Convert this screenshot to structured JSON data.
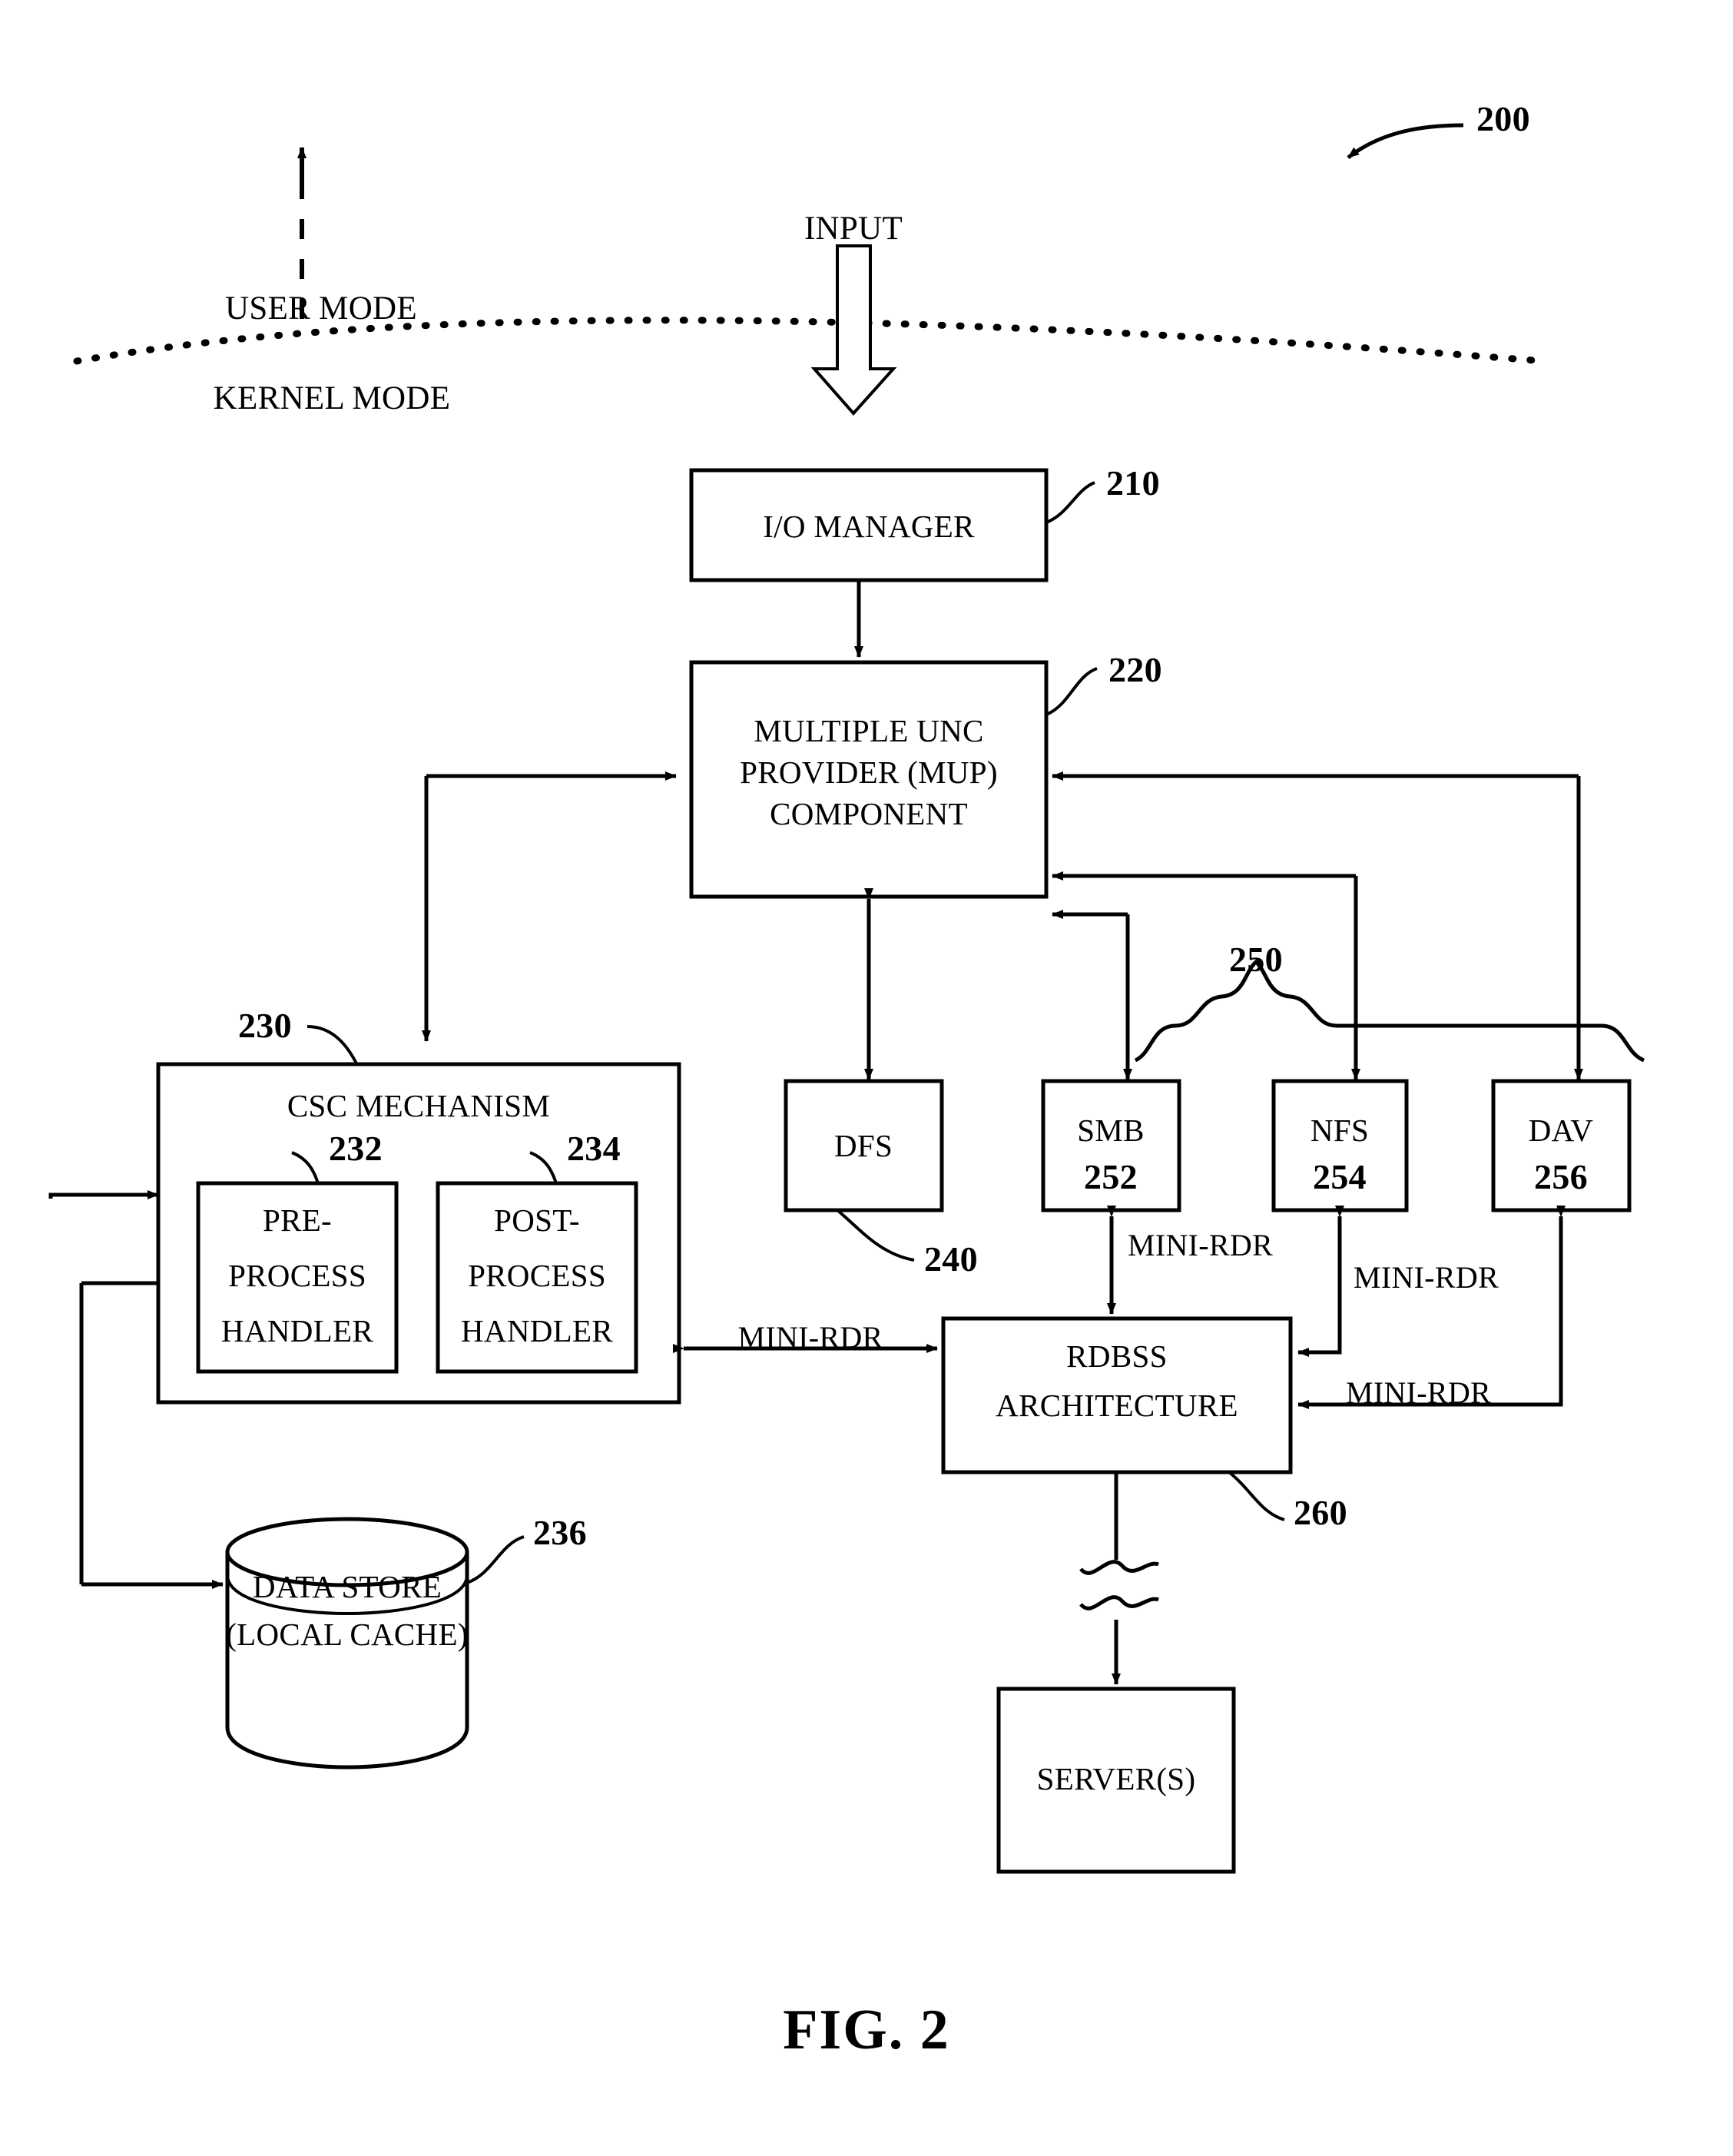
{
  "figure": {
    "caption": "FIG. 2",
    "reference_number": "200"
  },
  "mode_divider": {
    "user_mode_label": "USER MODE",
    "kernel_mode_label": "KERNEL MODE"
  },
  "input": {
    "label": "INPUT"
  },
  "boxes": {
    "io_manager": {
      "label": "I/O MANAGER",
      "ref": "210"
    },
    "mup": {
      "line1": "MULTIPLE UNC",
      "line2": "PROVIDER (MUP)",
      "line3": "COMPONENT",
      "ref": "220"
    },
    "csc": {
      "label": "CSC MECHANISM",
      "ref": "230"
    },
    "pre_process": {
      "line1": "PRE-",
      "line2": "PROCESS",
      "line3": "HANDLER",
      "ref": "232"
    },
    "post_process": {
      "line1": "POST-",
      "line2": "PROCESS",
      "line3": "HANDLER",
      "ref": "234"
    },
    "data_store": {
      "line1": "DATA STORE",
      "line2": "(LOCAL CACHE)",
      "ref": "236"
    },
    "dfs": {
      "label": "DFS",
      "ref": "240"
    },
    "smb": {
      "label": "SMB",
      "ref": "252"
    },
    "nfs": {
      "label": "NFS",
      "ref": "254"
    },
    "dav": {
      "label": "DAV",
      "ref": "256"
    },
    "redirector_group": {
      "ref": "250"
    },
    "rdbss": {
      "line1": "RDBSS",
      "line2": "ARCHITECTURE",
      "ref": "260"
    },
    "servers": {
      "label": "SERVER(S)"
    }
  },
  "edge_labels": {
    "mini_rdr_csc": "MINI-RDR",
    "mini_rdr_smb": "MINI-RDR",
    "mini_rdr_nfs": "MINI-RDR",
    "mini_rdr_dav": "MINI-RDR"
  },
  "colors": {
    "stroke": "#000000",
    "background": "#ffffff"
  }
}
